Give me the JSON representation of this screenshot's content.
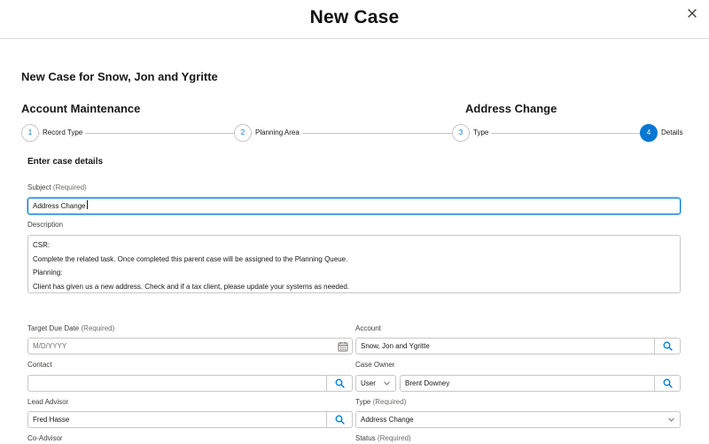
{
  "modal": {
    "title": "New Case",
    "close_icon": "close-icon"
  },
  "case_heading": "New Case for Snow, Jon and Ygritte",
  "sections": {
    "left": "Account Maintenance",
    "right": "Address Change"
  },
  "stepper": [
    {
      "number": "1",
      "label": "Record Type",
      "state": "complete"
    },
    {
      "number": "2",
      "label": "Planning Area",
      "state": "complete"
    },
    {
      "number": "3",
      "label": "Type",
      "state": "complete"
    },
    {
      "number": "4",
      "label": "Details",
      "state": "active"
    }
  ],
  "form": {
    "heading": "Enter case details",
    "subject": {
      "label": "Subject",
      "required": "(Required)",
      "value": "Address Change"
    },
    "description": {
      "label": "Description",
      "lines": [
        "CSR:",
        "Complete the related task. Once completed this parent case will be assigned to the Planning Queue.",
        "Planning:",
        "Client has given us a new address.  Check and if a tax client, please update your systems as needed."
      ]
    },
    "target_due_date": {
      "label": "Target Due Date",
      "required": "(Required)",
      "placeholder": "M/D/YYYY",
      "icon": "calendar-icon"
    },
    "account": {
      "label": "Account",
      "value": "Snow, Jon and Ygritte",
      "icon": "search-icon"
    },
    "contact": {
      "label": "Contact",
      "value": "",
      "icon": "search-icon"
    },
    "case_owner": {
      "label": "Case Owner",
      "owner_type": "User",
      "value": "Brent Downey",
      "icon": "search-icon"
    },
    "lead_advisor": {
      "label": "Lead Advisor",
      "value": "Fred Hasse",
      "icon": "search-icon"
    },
    "type": {
      "label": "Type",
      "required": "(Required)",
      "value": "Address Change"
    },
    "co_advisor": {
      "label": "Co-Advisor"
    },
    "status": {
      "label": "Status",
      "required": "(Required)"
    }
  },
  "colors": {
    "brand": "#0176d3",
    "border": "#c9c7c5",
    "text": "#181818",
    "muted": "#706e6b"
  }
}
